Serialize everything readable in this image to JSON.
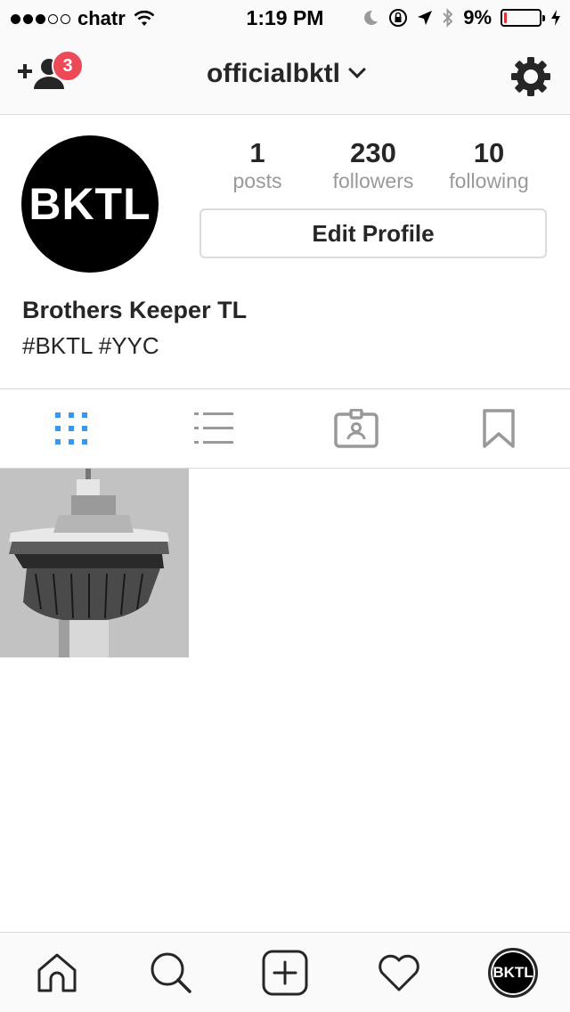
{
  "status_bar": {
    "carrier": "chatr",
    "time": "1:19 PM",
    "battery_percent": "9%",
    "battery_level": 0.09,
    "signal_dots_filled": 3,
    "signal_dots_total": 5
  },
  "header": {
    "username": "officialbktl",
    "notification_count": "3"
  },
  "profile": {
    "avatar_text": "BKTL",
    "stats": {
      "posts": {
        "value": "1",
        "label": "posts"
      },
      "followers": {
        "value": "230",
        "label": "followers"
      },
      "following": {
        "value": "10",
        "label": "following"
      }
    },
    "edit_button_label": "Edit Profile",
    "full_name": "Brothers Keeper TL",
    "bio": "#BKTL #YYC"
  },
  "tabs": [
    {
      "name": "grid-view",
      "icon": "grid-icon",
      "active": true
    },
    {
      "name": "list-view",
      "icon": "list-icon",
      "active": false
    },
    {
      "name": "tagged",
      "icon": "tagged-icon",
      "active": false
    },
    {
      "name": "saved",
      "icon": "bookmark-icon",
      "active": false
    }
  ],
  "posts": [
    {
      "description": "tower photo",
      "icon": "photo"
    }
  ],
  "bottom_nav": {
    "items": [
      "home-icon",
      "search-icon",
      "add-icon",
      "heart-icon",
      "profile-avatar"
    ],
    "avatar_text": "BKTL"
  },
  "colors": {
    "accent": "#3897f0",
    "badge": "#ed4956",
    "text": "#262626",
    "muted": "#999999",
    "border": "#dbdbdb"
  }
}
